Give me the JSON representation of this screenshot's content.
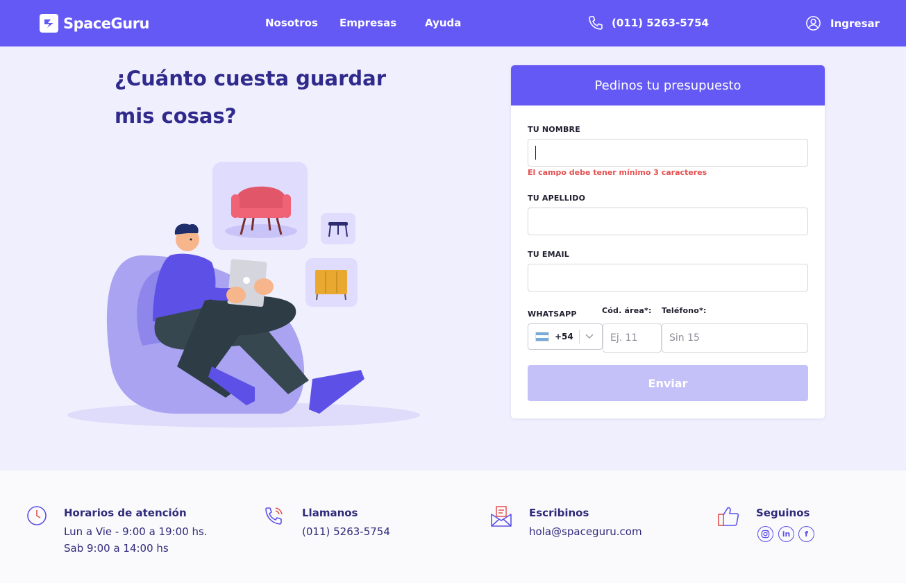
{
  "header": {
    "brand": "SpaceGuru",
    "nav": [
      "Nosotros",
      "Empresas",
      "Ayuda"
    ],
    "phone": "(011) 5263-5754",
    "login": "Ingresar"
  },
  "hero": {
    "title": "¿Cuánto cuesta guardar mis cosas?"
  },
  "form": {
    "title": "Pedinos tu presupuesto",
    "name_label": "TU NOMBRE",
    "name_value": "",
    "name_error": "El campo debe tener mínimo 3 caracteres",
    "lastname_label": "TU APELLIDO",
    "email_label": "TU EMAIL",
    "whatsapp_label": "WHATSAPP",
    "area_label": "Cód. área*:",
    "phone_label": "Teléfono*:",
    "country_code": "+54",
    "area_placeholder": "Ej. 11",
    "phone_placeholder": "Sin 15",
    "submit": "Enviar"
  },
  "footer": {
    "hours_title": "Horarios de atención",
    "hours_line1": "Lun a Vie - 9:00 a 19:00 hs.",
    "hours_line2": "Sab 9:00 a 14:00 hs",
    "call_title": "Llamanos",
    "call_phone": "(011) 5263-5754",
    "write_title": "Escribinos",
    "write_email": "hola@spaceguru.com",
    "follow_title": "Seguinos",
    "social": [
      "instagram",
      "linkedin",
      "facebook"
    ]
  },
  "colors": {
    "primary": "#6459F5",
    "title": "#2F2A8C",
    "error": "#E45050",
    "button_disabled": "#C4C0F8",
    "background": "#F0EFFD"
  }
}
